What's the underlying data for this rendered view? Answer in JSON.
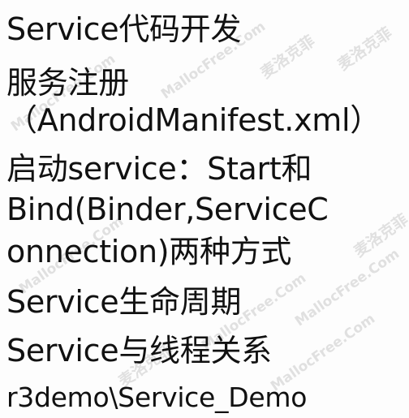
{
  "slide": {
    "lines": [
      "Service代码开发",
      "服务注册",
      "（AndroidManifest.xml）",
      "启动service：Start和",
      "Bind(Binder,ServiceC",
      "onnection)两种方式",
      "Service生命周期",
      "Service与线程关系",
      "r3demo\\Service_Demo"
    ],
    "watermarks": {
      "latin": "MallocFree.Com",
      "chinese": "麦洛克菲"
    }
  }
}
